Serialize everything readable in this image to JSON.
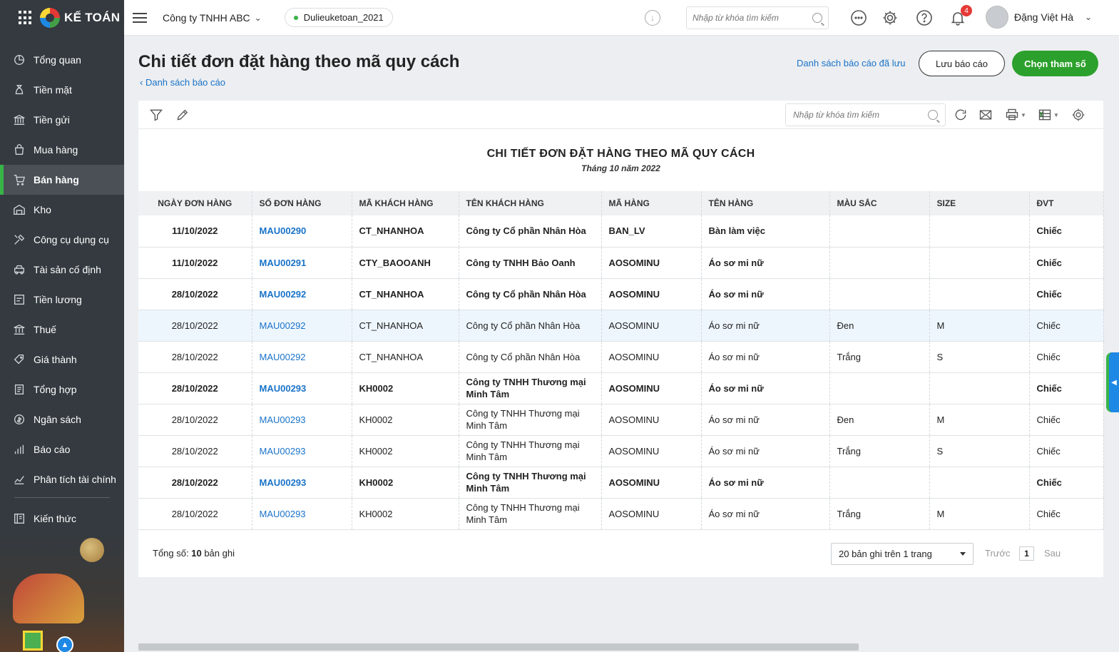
{
  "app": {
    "logo_text": "KẾ TOÁN"
  },
  "topbar": {
    "company": "Công ty TNHH ABC",
    "database": "Dulieuketoan_2021",
    "search_placeholder": "Nhập từ khóa tìm kiếm",
    "notification_count": "4",
    "user_name": "Đặng Việt Hà"
  },
  "sidebar": {
    "items": [
      {
        "label": "Tổng quan",
        "icon": "chart-pie-icon"
      },
      {
        "label": "Tiền mặt",
        "icon": "money-bag-icon"
      },
      {
        "label": "Tiền gửi",
        "icon": "bank-icon"
      },
      {
        "label": "Mua hàng",
        "icon": "shopping-bag-icon"
      },
      {
        "label": "Bán hàng",
        "icon": "cart-icon"
      },
      {
        "label": "Kho",
        "icon": "warehouse-icon"
      },
      {
        "label": "Công cụ dụng cụ",
        "icon": "tools-icon"
      },
      {
        "label": "Tài sản cố định",
        "icon": "car-icon"
      },
      {
        "label": "Tiền lương",
        "icon": "payroll-icon"
      },
      {
        "label": "Thuế",
        "icon": "tax-icon"
      },
      {
        "label": "Giá thành",
        "icon": "price-tag-icon"
      },
      {
        "label": "Tổng hợp",
        "icon": "ledger-icon"
      },
      {
        "label": "Ngân sách",
        "icon": "budget-icon"
      },
      {
        "label": "Báo cáo",
        "icon": "bar-chart-icon"
      },
      {
        "label": "Phân tích tài chính",
        "icon": "analysis-icon"
      }
    ],
    "extra_item": {
      "label": "Kiến thức",
      "icon": "book-icon"
    },
    "active_index": 4
  },
  "header": {
    "title": "Chi tiết đơn đặt hàng theo mã quy cách",
    "back_link": "Danh sách báo cáo",
    "saved_reports_link": "Danh sách báo cáo đã lưu",
    "save_button": "Lưu báo cáo",
    "params_button": "Chọn tham số"
  },
  "report": {
    "search_placeholder": "Nhập từ khóa tìm kiếm",
    "title": "CHI TIẾT ĐƠN ĐẶT HÀNG THEO MÃ QUY CÁCH",
    "subtitle": "Tháng 10 năm 2022",
    "columns": [
      "NGÀY ĐƠN HÀNG",
      "SỐ ĐƠN HÀNG",
      "MÃ KHÁCH HÀNG",
      "TÊN KHÁCH HÀNG",
      "MÃ HÀNG",
      "TÊN HÀNG",
      "MÀU SẮC",
      "SIZE",
      "ĐVT"
    ],
    "rows": [
      {
        "bold": true,
        "cells": [
          "11/10/2022",
          "MAU00290",
          "CT_NHANHOA",
          "Công ty Cổ phần Nhân Hòa",
          "BAN_LV",
          "Bàn làm việc",
          "",
          "",
          "Chiếc"
        ]
      },
      {
        "bold": true,
        "cells": [
          "11/10/2022",
          "MAU00291",
          "CTY_BAOOANH",
          "Công ty TNHH Bảo Oanh",
          "AOSOMINU",
          "Áo sơ mi nữ",
          "",
          "",
          "Chiếc"
        ]
      },
      {
        "bold": true,
        "cells": [
          "28/10/2022",
          "MAU00292",
          "CT_NHANHOA",
          "Công ty Cổ phần Nhân Hòa",
          "AOSOMINU",
          "Áo sơ mi nữ",
          "",
          "",
          "Chiếc"
        ]
      },
      {
        "bold": false,
        "cells": [
          "28/10/2022",
          "MAU00292",
          "CT_NHANHOA",
          "Công ty Cổ phần Nhân Hòa",
          "AOSOMINU",
          "Áo sơ mi nữ",
          "Đen",
          "M",
          "Chiếc"
        ]
      },
      {
        "bold": false,
        "cells": [
          "28/10/2022",
          "MAU00292",
          "CT_NHANHOA",
          "Công ty Cổ phần Nhân Hòa",
          "AOSOMINU",
          "Áo sơ mi nữ",
          "Trắng",
          "S",
          "Chiếc"
        ]
      },
      {
        "bold": true,
        "cells": [
          "28/10/2022",
          "MAU00293",
          "KH0002",
          "Công ty TNHH Thương mại Minh Tâm",
          "AOSOMINU",
          "Áo sơ mi nữ",
          "",
          "",
          "Chiếc"
        ]
      },
      {
        "bold": false,
        "cells": [
          "28/10/2022",
          "MAU00293",
          "KH0002",
          "Công ty TNHH Thương mại Minh Tâm",
          "AOSOMINU",
          "Áo sơ mi nữ",
          "Đen",
          "M",
          "Chiếc"
        ]
      },
      {
        "bold": false,
        "cells": [
          "28/10/2022",
          "MAU00293",
          "KH0002",
          "Công ty TNHH Thương mại Minh Tâm",
          "AOSOMINU",
          "Áo sơ mi nữ",
          "Trắng",
          "S",
          "Chiếc"
        ]
      },
      {
        "bold": true,
        "cells": [
          "28/10/2022",
          "MAU00293",
          "KH0002",
          "Công ty TNHH Thương mại Minh Tâm",
          "AOSOMINU",
          "Áo sơ mi nữ",
          "",
          "",
          "Chiếc"
        ]
      },
      {
        "bold": false,
        "cells": [
          "28/10/2022",
          "MAU00293",
          "KH0002",
          "Công ty TNHH Thương mại Minh Tâm",
          "AOSOMINU",
          "Áo sơ mi nữ",
          "Trắng",
          "M",
          "Chiếc"
        ]
      }
    ],
    "highlighted_row": 3,
    "footer": {
      "total_prefix": "Tổng số:",
      "total_count": "10",
      "total_suffix": "bản ghi",
      "page_size": "20 bản ghi trên 1 trang",
      "prev": "Trước",
      "page": "1",
      "next": "Sau"
    }
  },
  "colors": {
    "accent_green": "#2ca02c",
    "link_blue": "#1a73c8",
    "sidebar_bg": "#343a40"
  }
}
